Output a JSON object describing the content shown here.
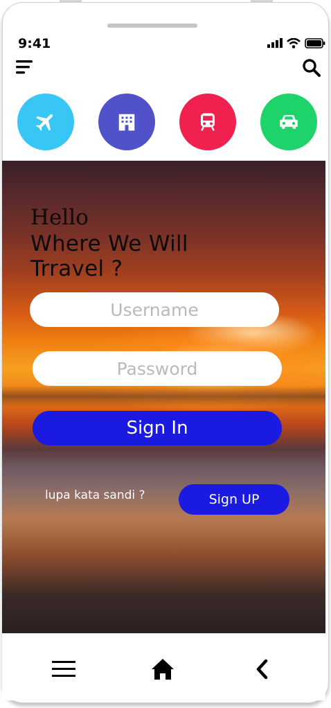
{
  "status_bar": {
    "time": "9:41"
  },
  "header": {
    "menu_icon": "menu-icon",
    "search_icon": "search-icon"
  },
  "categories": [
    {
      "icon": "airplane-icon",
      "color": "#38c6f4"
    },
    {
      "icon": "hotel-icon",
      "color": "#5151c9"
    },
    {
      "icon": "train-icon",
      "color": "#f0204f"
    },
    {
      "icon": "car-icon",
      "color": "#1dd36a"
    }
  ],
  "hero": {
    "greeting": "Hello",
    "headline_line1": "Where We Will",
    "headline_line2": "Trravel ?"
  },
  "login": {
    "username_placeholder": "Username",
    "password_placeholder": "Password",
    "signin_label": "Sign In",
    "forgot_label": "lupa kata sandi ?",
    "signup_label": "Sign UP",
    "accent": "#1a1ae0"
  },
  "bottom_nav": {
    "icons": [
      "menu-icon",
      "home-icon",
      "back-icon"
    ]
  }
}
